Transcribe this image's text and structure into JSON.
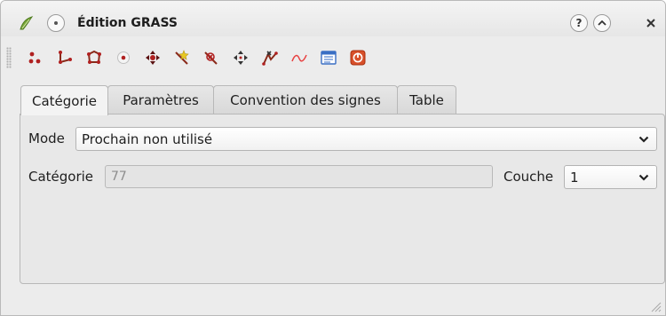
{
  "window": {
    "title": "Édition GRASS",
    "help_symbol": "?",
    "colors": {
      "accent": "#b02020",
      "star": "#e8c820",
      "curve": "#e84040",
      "table": "#3a6fc4",
      "exit": "#d8502a"
    }
  },
  "toolbar": {
    "tools": [
      {
        "icon": "new-points-icon"
      },
      {
        "icon": "new-line-icon"
      },
      {
        "icon": "new-boundary-icon"
      },
      {
        "icon": "new-centroid-icon"
      },
      {
        "icon": "move-vertex-icon"
      },
      {
        "icon": "add-vertex-icon"
      },
      {
        "icon": "delete-vertex-icon"
      },
      {
        "icon": "move-element-icon"
      },
      {
        "icon": "split-line-icon"
      },
      {
        "icon": "edit-line-icon"
      },
      {
        "icon": "attribute-table-icon"
      },
      {
        "icon": "close-edit-icon"
      }
    ]
  },
  "tabs": [
    {
      "label": "Catégorie"
    },
    {
      "label": "Paramètres"
    },
    {
      "label": "Convention des signes"
    },
    {
      "label": "Table"
    }
  ],
  "category_tab": {
    "mode_label": "Mode",
    "mode_value": "Prochain non utilisé",
    "category_label": "Catégorie",
    "category_value": "77",
    "layer_label": "Couche",
    "layer_value": "1"
  }
}
